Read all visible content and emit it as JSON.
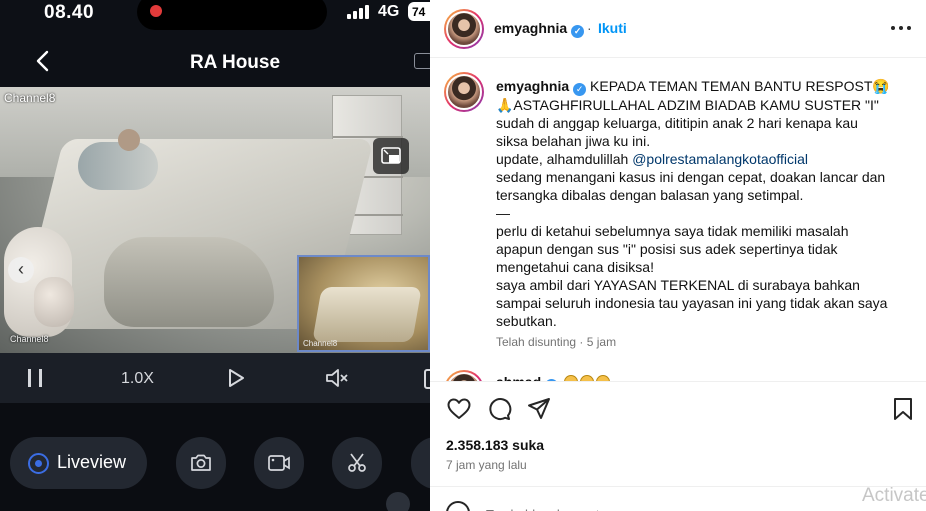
{
  "phone": {
    "status": {
      "time": "08.40",
      "network": "4G",
      "battery": "74"
    },
    "app_title": "RA House",
    "camera": {
      "channel_label_main": "Channel8",
      "channel_label_corner": "Channel8",
      "pip_label": "Channel8"
    },
    "controls": {
      "zoom_level": "1.0X"
    },
    "bottom": {
      "liveview_label": "Liveview"
    }
  },
  "post": {
    "username": "emyaghnia",
    "verified": true,
    "follow_label": "Ikuti",
    "caption": {
      "username": "emyaghnia",
      "line1": "KEPADA TEMAN TEMAN BANTU RESPOST😭",
      "line2": "🙏ASTAGHFIRULLAHAL ADZIM BIADAB KAMU SUSTER \"I\"",
      "line3": "sudah di anggap keluarga, dititipin anak 2 hari kenapa kau",
      "line4": "siksa belahan jiwa ku ini.",
      "line5_prefix": "update, alhamdulillah ",
      "line5_mention": "@polrestamalangkotaofficial",
      "line6": "sedang menangani kasus ini dengan cepat, doakan lancar dan",
      "line7": "tersangka dibalas dengan balasan yang setimpal.",
      "line8": "—",
      "line9": "perlu di ketahui sebelumnya saya tidak memiliki masalah",
      "line10": "apapun dengan sus \"i\" posisi sus adek sepertinya tidak",
      "line11": "mengetahui cana disiksa!",
      "line12": "saya ambil dari YAYASAN TERKENAL di surabaya bahkan",
      "line13": "sampai seluruh indonesia tau yayasan ini yang tidak akan saya",
      "line14": "sebutkan."
    },
    "edited_time": "Telah disunting · 5 jam",
    "comment_peek_name": "ahmad",
    "likes": "2.358.183 suka",
    "posted_ago": "7 jam yang lalu",
    "comment_placeholder": "Tambahkan komentar...",
    "watermark": "Activate"
  },
  "colors": {
    "follow_blue": "#0095f6",
    "verified_blue": "#3897f0",
    "liveview_blue": "#3b6de3",
    "record_red": "#e23b3b"
  },
  "icons": [
    "back-icon",
    "cast-icon",
    "fullscreen-icon",
    "pause-icon",
    "play-icon",
    "mute-icon",
    "camera-icon",
    "video-icon",
    "scissors-icon",
    "heart-icon",
    "comment-icon",
    "share-icon",
    "bookmark-icon",
    "more-icon",
    "emoji-icon"
  ]
}
